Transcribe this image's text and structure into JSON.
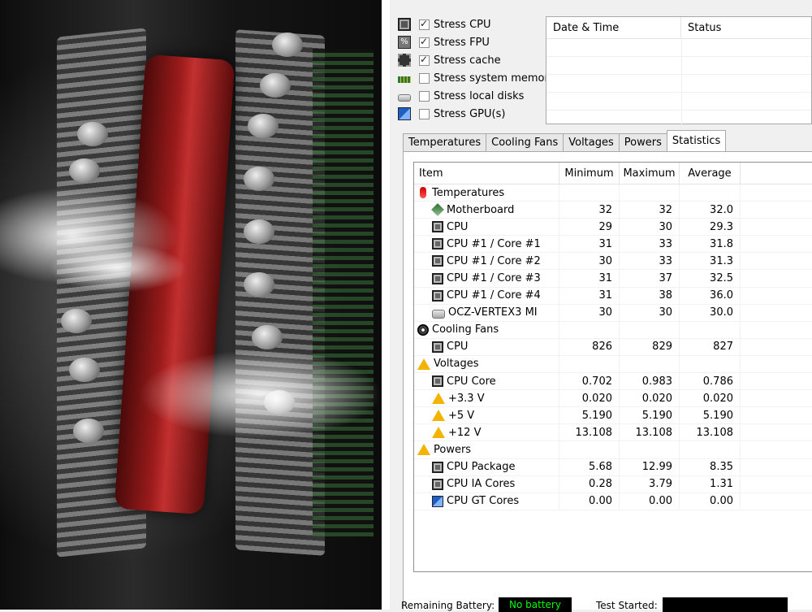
{
  "stress_options": [
    {
      "label": "Stress CPU",
      "checked": true,
      "icon": "cpu-chip-icon"
    },
    {
      "label": "Stress FPU",
      "checked": true,
      "icon": "fpu-icon"
    },
    {
      "label": "Stress cache",
      "checked": true,
      "icon": "cache-chip-icon"
    },
    {
      "label": "Stress system memory",
      "checked": false,
      "icon": "memory-icon"
    },
    {
      "label": "Stress local disks",
      "checked": false,
      "icon": "disk-icon"
    },
    {
      "label": "Stress GPU(s)",
      "checked": false,
      "icon": "gpu-icon"
    }
  ],
  "log": {
    "columns": [
      "Date & Time",
      "Status"
    ]
  },
  "tabs": [
    "Temperatures",
    "Cooling Fans",
    "Voltages",
    "Powers",
    "Statistics"
  ],
  "active_tab": "Statistics",
  "stats": {
    "columns": [
      "Item",
      "Minimum",
      "Maximum",
      "Average"
    ],
    "rows": [
      {
        "kind": "group",
        "icon": "thermometer-icon",
        "item": "Temperatures",
        "min": "",
        "max": "",
        "avg": ""
      },
      {
        "kind": "child",
        "icon": "motherboard-icon",
        "item": "Motherboard",
        "min": "32",
        "max": "32",
        "avg": "32.0"
      },
      {
        "kind": "child",
        "icon": "cpu-icon",
        "item": "CPU",
        "min": "29",
        "max": "30",
        "avg": "29.3"
      },
      {
        "kind": "child",
        "icon": "cpu-icon",
        "item": "CPU #1 / Core #1",
        "min": "31",
        "max": "33",
        "avg": "31.8"
      },
      {
        "kind": "child",
        "icon": "cpu-icon",
        "item": "CPU #1 / Core #2",
        "min": "30",
        "max": "33",
        "avg": "31.3"
      },
      {
        "kind": "child",
        "icon": "cpu-icon",
        "item": "CPU #1 / Core #3",
        "min": "31",
        "max": "37",
        "avg": "32.5"
      },
      {
        "kind": "child",
        "icon": "cpu-icon",
        "item": "CPU #1 / Core #4",
        "min": "31",
        "max": "38",
        "avg": "36.0"
      },
      {
        "kind": "child",
        "icon": "disk-icon",
        "item": "OCZ-VERTEX3 MI",
        "min": "30",
        "max": "30",
        "avg": "30.0"
      },
      {
        "kind": "group",
        "icon": "fan-icon",
        "item": "Cooling Fans",
        "min": "",
        "max": "",
        "avg": ""
      },
      {
        "kind": "child",
        "icon": "cpu-icon",
        "item": "CPU",
        "min": "826",
        "max": "829",
        "avg": "827"
      },
      {
        "kind": "group",
        "icon": "warning-icon",
        "item": "Voltages",
        "min": "",
        "max": "",
        "avg": ""
      },
      {
        "kind": "child",
        "icon": "cpu-icon",
        "item": "CPU Core",
        "min": "0.702",
        "max": "0.983",
        "avg": "0.786"
      },
      {
        "kind": "child",
        "icon": "warning-icon",
        "item": "+3.3 V",
        "min": "0.020",
        "max": "0.020",
        "avg": "0.020"
      },
      {
        "kind": "child",
        "icon": "warning-icon",
        "item": "+5 V",
        "min": "5.190",
        "max": "5.190",
        "avg": "5.190"
      },
      {
        "kind": "child",
        "icon": "warning-icon",
        "item": "+12 V",
        "min": "13.108",
        "max": "13.108",
        "avg": "13.108"
      },
      {
        "kind": "group",
        "icon": "warning-icon",
        "item": "Powers",
        "min": "",
        "max": "",
        "avg": ""
      },
      {
        "kind": "child",
        "icon": "cpu-icon",
        "item": "CPU Package",
        "min": "5.68",
        "max": "12.99",
        "avg": "8.35"
      },
      {
        "kind": "child",
        "icon": "cpu-icon",
        "item": "CPU IA Cores",
        "min": "0.28",
        "max": "3.79",
        "avg": "1.31"
      },
      {
        "kind": "child",
        "icon": "gpu-icon",
        "item": "CPU GT Cores",
        "min": "0.00",
        "max": "0.00",
        "avg": "0.00"
      }
    ]
  },
  "statusbar": {
    "battery_label": "Remaining Battery:",
    "battery_value": "No battery",
    "test_started_label": "Test Started:",
    "test_started_value": ""
  },
  "colors": {
    "status_box_bg": "#000000",
    "status_box_text": "#00ff00",
    "warning": "#f2b400"
  }
}
